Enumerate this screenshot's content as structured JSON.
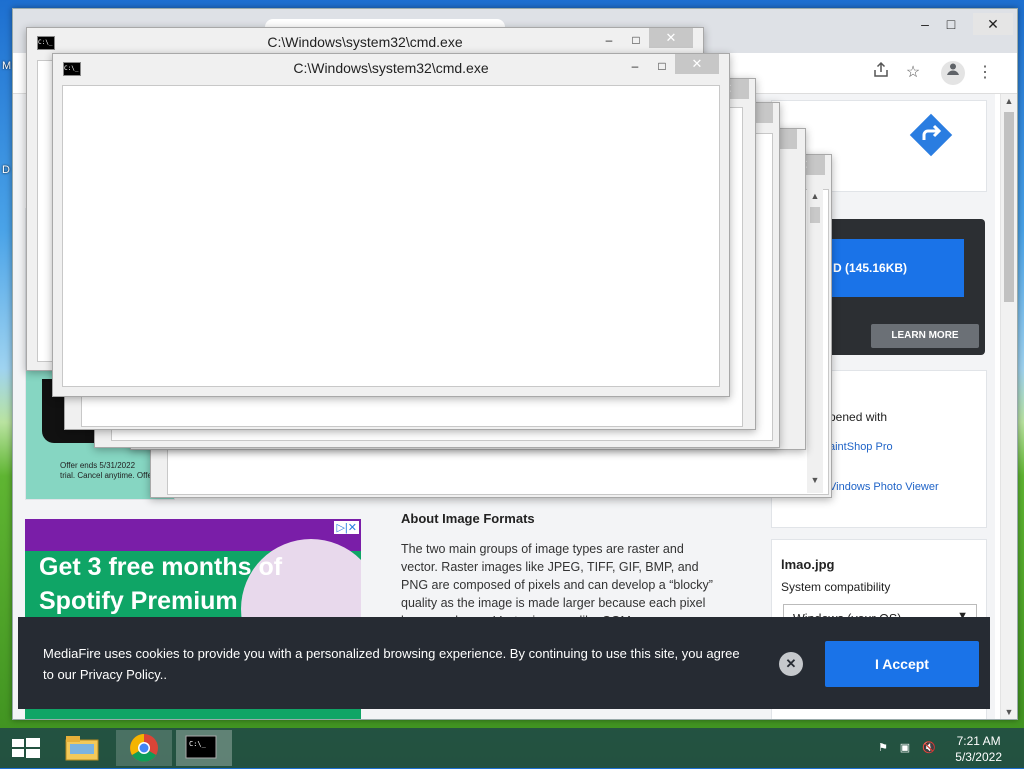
{
  "desktop": {
    "frag_1": "M",
    "frag_2": "D"
  },
  "browser": {
    "window_controls": {
      "minimize": "–",
      "maximize": "□",
      "close": "✕"
    },
    "toolbar": {
      "share_icon": "share-icon",
      "bookmark_icon": "star-icon",
      "profile_icon": "profile-icon",
      "menu_icon": "kebab-menu-icon"
    },
    "download_button_label": "D (145.16KB)",
    "learn_more_label": "LEARN MORE",
    "opened_with_label": "pened with",
    "apps": [
      "aintShop Pro",
      "Vindows Photo Viewer"
    ],
    "ad_fragment": {
      "line1": "Offer ends 5/31/2022",
      "line2": "trial. Cancel anytime. Offer a"
    },
    "spotify_ad": {
      "line1": "Get 3 free months of",
      "line2": "Spotify Premium",
      "adchoices": "▷|✕"
    },
    "about_heading": "About Image Formats",
    "about_paragraph": "The two main groups of image types are raster and vector. Raster images like JPEG, TIFF, GIF, BMP, and PNG are composed of pixels and can develop a “blocky” quality as the image is made larger because each pixel becomes larger. Vector images, like CGM",
    "file_name": "lmao.jpg",
    "system_compat_label": "System compatibility",
    "os_select_value": "Windows (your OS)",
    "colors": {
      "accent": "#1a73e8",
      "cookie_bg": "#262b33",
      "ad_green": "#0fa566"
    }
  },
  "cmd_windows": {
    "title": "C:\\Windows\\system32\\cmd.exe",
    "close": "✕",
    "minimize": "–",
    "maximize": "□"
  },
  "cookie": {
    "message": "MediaFire uses cookies to provide you with a personalized browsing experience. By continuing to use this site, you agree to our Privacy Policy..",
    "close": "✕",
    "accept_label": "I Accept"
  },
  "taskbar": {
    "apps": [
      "file-explorer-icon",
      "chrome-icon",
      "cmd-icon"
    ],
    "time": "7:21 AM",
    "date": "5/3/2022"
  }
}
